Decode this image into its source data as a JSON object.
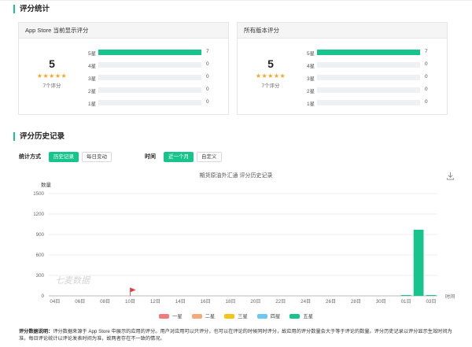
{
  "section1": {
    "title": "评分统计"
  },
  "cards": [
    {
      "title": "App Store 当前显示评分",
      "score": "5",
      "stars": "★★★★★",
      "count_label": "7个评分",
      "rows": [
        {
          "label": "5星",
          "count": "7",
          "fraction": 1.0
        },
        {
          "label": "4星",
          "count": "0",
          "fraction": 0
        },
        {
          "label": "3星",
          "count": "0",
          "fraction": 0
        },
        {
          "label": "2星",
          "count": "0",
          "fraction": 0
        },
        {
          "label": "1星",
          "count": "0",
          "fraction": 0
        }
      ]
    },
    {
      "title": "所有版本评分",
      "score": "5",
      "stars": "★★★★★",
      "count_label": "7个评分",
      "rows": [
        {
          "label": "5星",
          "count": "7",
          "fraction": 1.0
        },
        {
          "label": "4星",
          "count": "0",
          "fraction": 0
        },
        {
          "label": "3星",
          "count": "0",
          "fraction": 0
        },
        {
          "label": "2星",
          "count": "0",
          "fraction": 0
        },
        {
          "label": "1星",
          "count": "0",
          "fraction": 0
        }
      ]
    }
  ],
  "section2": {
    "title": "评分历史记录"
  },
  "filters": {
    "method_label": "统计方式",
    "method_options": [
      "历史记录",
      "每日变动"
    ],
    "method_selected": 0,
    "time_label": "时间",
    "time_options": [
      "近一个月",
      "自定义"
    ],
    "time_selected": 0
  },
  "chart_data": {
    "type": "bar",
    "title": "期货原油外汇通 评分历史记录",
    "ylabel": "数量",
    "xlabel": "时间",
    "ylim": [
      0,
      1500
    ],
    "yticks": [
      0,
      300,
      600,
      900,
      1200,
      1500
    ],
    "categories": [
      "04日",
      "05日",
      "06日",
      "07日",
      "08日",
      "09日",
      "10日",
      "11日",
      "12日",
      "13日",
      "14日",
      "15日",
      "16日",
      "17日",
      "18日",
      "19日",
      "20日",
      "21日",
      "22日",
      "23日",
      "24日",
      "25日",
      "26日",
      "27日",
      "28日",
      "29日",
      "30日",
      "31日",
      "01日",
      "02日",
      "03日"
    ],
    "tick_labels": [
      "04日",
      "06日",
      "08日",
      "10日",
      "12日",
      "14日",
      "16日",
      "18日",
      "20日",
      "22日",
      "24日",
      "26日",
      "28日",
      "30日",
      "01日",
      "03日"
    ],
    "series": [
      {
        "name": "一星",
        "color": "#f07c7c",
        "values": [
          0,
          0,
          0,
          0,
          0,
          0,
          0,
          0,
          0,
          0,
          0,
          0,
          0,
          0,
          0,
          0,
          0,
          0,
          0,
          0,
          0,
          0,
          0,
          0,
          0,
          0,
          0,
          0,
          0,
          0,
          0
        ]
      },
      {
        "name": "二星",
        "color": "#f5a97a",
        "values": [
          0,
          0,
          0,
          0,
          0,
          0,
          0,
          0,
          0,
          0,
          0,
          0,
          0,
          0,
          0,
          0,
          0,
          0,
          0,
          0,
          0,
          0,
          0,
          0,
          0,
          0,
          0,
          0,
          0,
          0,
          0
        ]
      },
      {
        "name": "三星",
        "color": "#f5c518",
        "values": [
          0,
          0,
          0,
          0,
          0,
          0,
          0,
          0,
          0,
          0,
          0,
          0,
          0,
          0,
          0,
          0,
          0,
          0,
          0,
          0,
          0,
          0,
          0,
          0,
          0,
          0,
          0,
          0,
          0,
          0,
          0
        ]
      },
      {
        "name": "四星",
        "color": "#6cc8f2",
        "values": [
          0,
          0,
          0,
          0,
          0,
          0,
          0,
          0,
          0,
          0,
          0,
          0,
          0,
          0,
          0,
          0,
          0,
          0,
          0,
          0,
          0,
          0,
          0,
          0,
          0,
          0,
          0,
          0,
          0,
          0,
          0
        ]
      },
      {
        "name": "五星",
        "color": "#17c48c",
        "values": [
          0,
          0,
          0,
          0,
          0,
          0,
          0,
          0,
          0,
          0,
          0,
          0,
          0,
          0,
          0,
          0,
          0,
          0,
          0,
          0,
          0,
          0,
          0,
          0,
          0,
          0,
          0,
          0,
          7,
          970,
          7
        ]
      }
    ],
    "watermark": "七麦数据",
    "grid": true,
    "legend": "bottom-center"
  },
  "note": {
    "label": "评分数据说明：",
    "text": "评分数据来源于 App Store 中展示的应用的评分。用户对应用可以只评分，也可以在评论的时候同时评分，故应用的评分数量会大于等于评论的数量。评分历史记录以评分显示生效时间为准，每日评论统计以评论发表时间为准，故两者存在不一致的情况。"
  }
}
